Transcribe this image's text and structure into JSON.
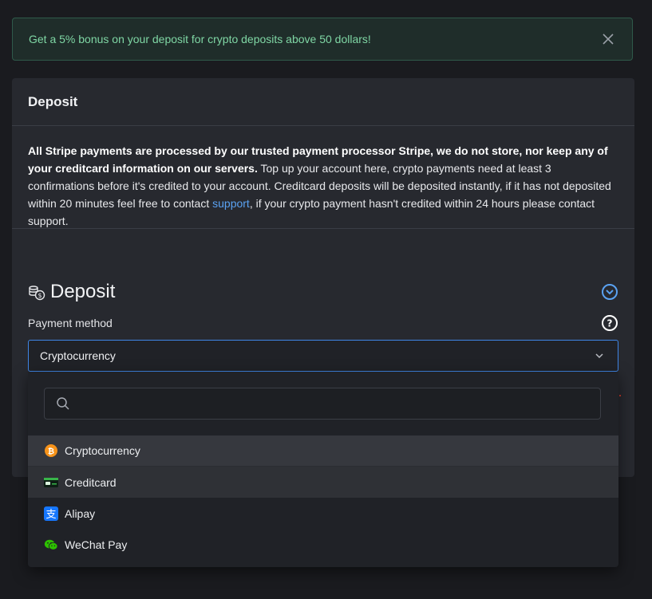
{
  "alert": {
    "message": "Get a 5% bonus on your deposit for crypto deposits above 50 dollars!",
    "close_icon": "close-icon"
  },
  "card": {
    "header": "Deposit",
    "notice_bold": "All Stripe payments are processed by our trusted payment processor Stripe, we do not store, nor keep any of your creditcard information on our servers.",
    "notice_text_1": " Top up your account here, crypto payments need at least 3 confirmations before it's credited to your account. Creditcard deposits will be deposited instantly, if it has not deposited within 20 minutes feel free to contact ",
    "notice_link": "support",
    "notice_text_2": ", if your crypto payment hasn't credited within 24 hours please contact support."
  },
  "deposit_section": {
    "title": "Deposit",
    "title_icon": "coins-icon",
    "collapse_icon": "chevron-circle-down-icon",
    "payment_method_label": "Payment method",
    "help_icon": "question-circle-icon"
  },
  "select": {
    "value": "Cryptocurrency",
    "chevron_icon": "chevron-down-icon"
  },
  "dropdown": {
    "search_placeholder": "",
    "search_icon": "search-icon",
    "options": [
      {
        "label": "Cryptocurrency",
        "icon": "bitcoin-icon",
        "state": "selected"
      },
      {
        "label": "Creditcard",
        "icon": "credit-card-icon",
        "state": "hover"
      },
      {
        "label": "Alipay",
        "icon": "alipay-icon",
        "state": ""
      },
      {
        "label": "WeChat Pay",
        "icon": "wechat-icon",
        "state": ""
      }
    ]
  },
  "colors": {
    "background": "#1a1b1f",
    "card": "#27292f",
    "alert_text": "#7fd6a4",
    "link": "#5aa2f2",
    "focus_border": "#3f86e6",
    "bitcoin": "#f7931a",
    "alipay": "#1677ff",
    "wechat": "#09bb07"
  }
}
